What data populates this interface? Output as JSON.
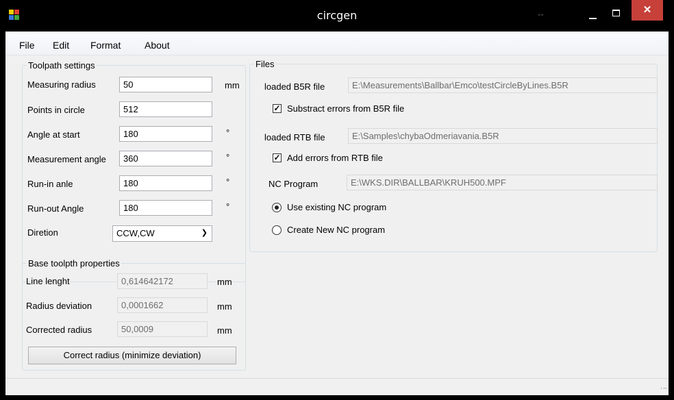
{
  "window": {
    "title": "circgen"
  },
  "menu": [
    "File",
    "Edit",
    "Format",
    "About"
  ],
  "toolpath": {
    "legend": "Toolpath settings",
    "rows": [
      {
        "label": "Measuring radius",
        "value": "50",
        "unit": "mm"
      },
      {
        "label": "Points in circle",
        "value": "512",
        "unit": ""
      },
      {
        "label": "Angle at start",
        "value": "180",
        "unit": "°"
      },
      {
        "label": "Measurement angle",
        "value": "360",
        "unit": "°"
      },
      {
        "label": "Run-in anle",
        "value": "180",
        "unit": "°"
      },
      {
        "label": "Run-out Angle",
        "value": "180",
        "unit": "°"
      }
    ],
    "direction_label": "Diretion",
    "direction_value": "CCW,CW"
  },
  "base": {
    "legend": "Base toolpth properties",
    "rows": [
      {
        "label": "Line lenght",
        "value": "0,614642172",
        "unit": "mm"
      },
      {
        "label": "Radius deviation",
        "value": "0,0001662",
        "unit": "mm"
      },
      {
        "label": "Corrected radius",
        "value": "50,0009",
        "unit": "mm"
      }
    ],
    "button": "Correct radius (minimize deviation)"
  },
  "files": {
    "legend": "Files",
    "b5r_label": "loaded B5R file",
    "b5r_path": "E:\\Measurements\\Ballbar\\Emco\\testCircleByLines.B5R",
    "subtract_label": "Substract errors from B5R file",
    "subtract_checked": true,
    "rtb_label": "loaded RTB file",
    "rtb_path": "E:\\Samples\\chybaOdmeriavania.B5R",
    "add_label": "Add errors from RTB file",
    "add_checked": true,
    "nc_label": "NC Program",
    "nc_path": "E:\\WKS.DIR\\BALLBAR\\KRUH500.MPF",
    "use_existing_label": "Use existing NC program",
    "create_new_label": "Create New NC program",
    "selected_option": "use_existing"
  }
}
